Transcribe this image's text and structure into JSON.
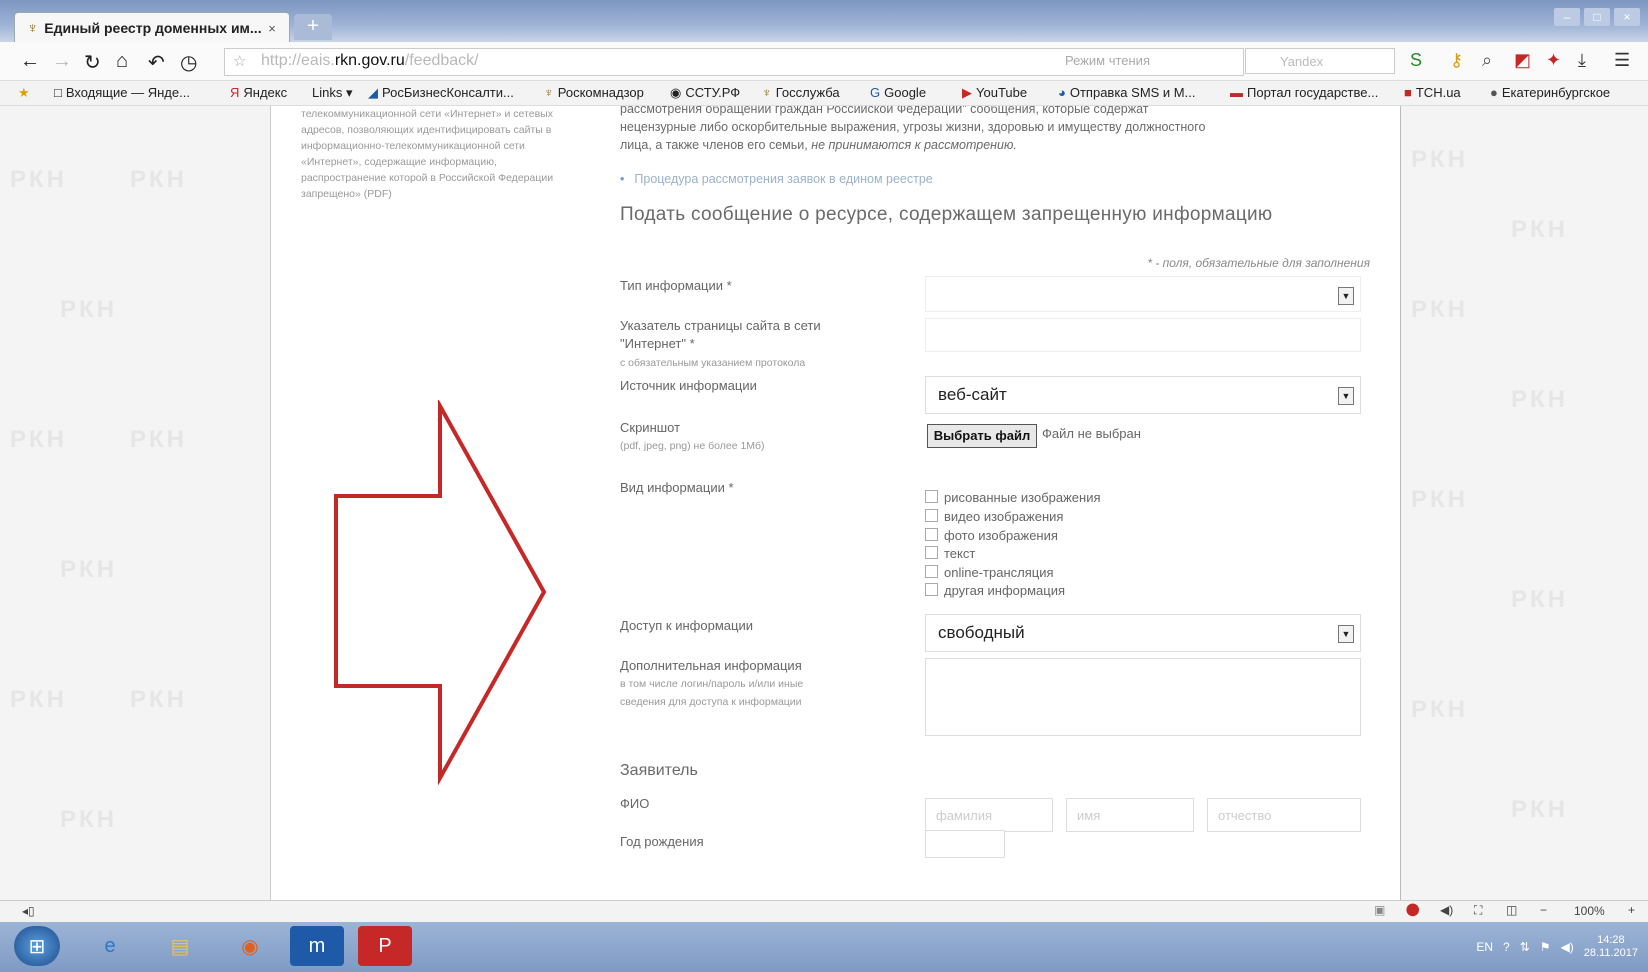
{
  "browser": {
    "tab_title": "Единый реестр доменных им...",
    "tab_close": "×",
    "new_tab": "+",
    "url_prefix": "http://eais.",
    "url_domain": "rkn.gov.ru",
    "url_path": "/feedback/",
    "reader_mode": "Режим чтения",
    "search_placeholder": "Yandex"
  },
  "bookmarks": [
    {
      "icon": "□",
      "label": "Входящие — Янде..."
    },
    {
      "icon": "Я",
      "label": "Яндекс"
    },
    {
      "icon": "",
      "label": "Links"
    },
    {
      "icon": "◢",
      "label": "РосБизнесКонсалти..."
    },
    {
      "icon": "♆",
      "label": "Роскомнадзор"
    },
    {
      "icon": "◉",
      "label": "ССТУ.РФ"
    },
    {
      "icon": "♆",
      "label": "Госслужба"
    },
    {
      "icon": "G",
      "label": "Google"
    },
    {
      "icon": "▶",
      "label": "YouTube"
    },
    {
      "icon": "◕",
      "label": "Отправка SMS и М..."
    },
    {
      "icon": "▬",
      "label": "Портал государстве..."
    },
    {
      "icon": "■",
      "label": "TCH.ua"
    },
    {
      "icon": "●",
      "label": "Екатеринбургское"
    }
  ],
  "watermark": "РКН",
  "left_text": "телекоммуникационной сети «Интернет» и сетевых адресов, позволяющих идентифицировать сайты в информационно-телекоммуникационной сети «Интернет», содержащие информацию, распространение которой в Российской Федерации запрещено» (PDF)",
  "content": {
    "intro_line1": "рассмотрения обращений граждан Российской Федерации\" сообщения, которые содержат",
    "intro_line2": "нецензурные либо оскорбительные выражения, угрозы жизни, здоровью и имуществу должностного",
    "intro_line3a": "лица, а также членов его семьи,",
    "intro_line3b": "не принимаются к рассмотрению.",
    "procedure_link": "Процедура рассмотрения заявок в едином реестре",
    "heading": "Подать сообщение о ресурсе, содержащем запрещенную информацию",
    "required_note": "* - поля, обязательные для заполнения"
  },
  "form": {
    "type_label": "Тип информации *",
    "pointer_label1": "Указатель страницы сайта в сети",
    "pointer_label2": "\"Интернет\" *",
    "pointer_hint": "с обязательным указанием протокола",
    "source_label": "Источник информации",
    "source_value": "веб-сайт",
    "screenshot_label": "Скриншот",
    "screenshot_hint": "(pdf, jpeg, png) не более 1Мб)",
    "file_button": "Выбрать файл",
    "file_status": "Файл не выбран",
    "kind_label": "Вид информации *",
    "kind_options": [
      "рисованные изображения",
      "видео изображения",
      "фото изображения",
      "текст",
      "online-трансляция",
      "другая информация"
    ],
    "access_label": "Доступ к информации",
    "access_value": "свободный",
    "extra_label": "Дополнительная информация",
    "extra_hint1": "в том числе логин/пароль и/или иные",
    "extra_hint2": "сведения для доступа к информации",
    "applicant_heading": "Заявитель",
    "fio_label": "ФИО",
    "surname_placeholder": "фамилия",
    "name_placeholder": "имя",
    "patronymic_placeholder": "отчество",
    "birth_year_label": "Год рождения"
  },
  "statusbar": {
    "zoom": "100%",
    "zoom_minus": "−",
    "zoom_plus": "+"
  },
  "taskbar": {
    "lang": "EN",
    "time": "14:28",
    "date": "28.11.2017"
  },
  "colors": {
    "arrow": "#c62828",
    "link": "#9bb2c8",
    "taskbar": "#8aa4cc"
  }
}
